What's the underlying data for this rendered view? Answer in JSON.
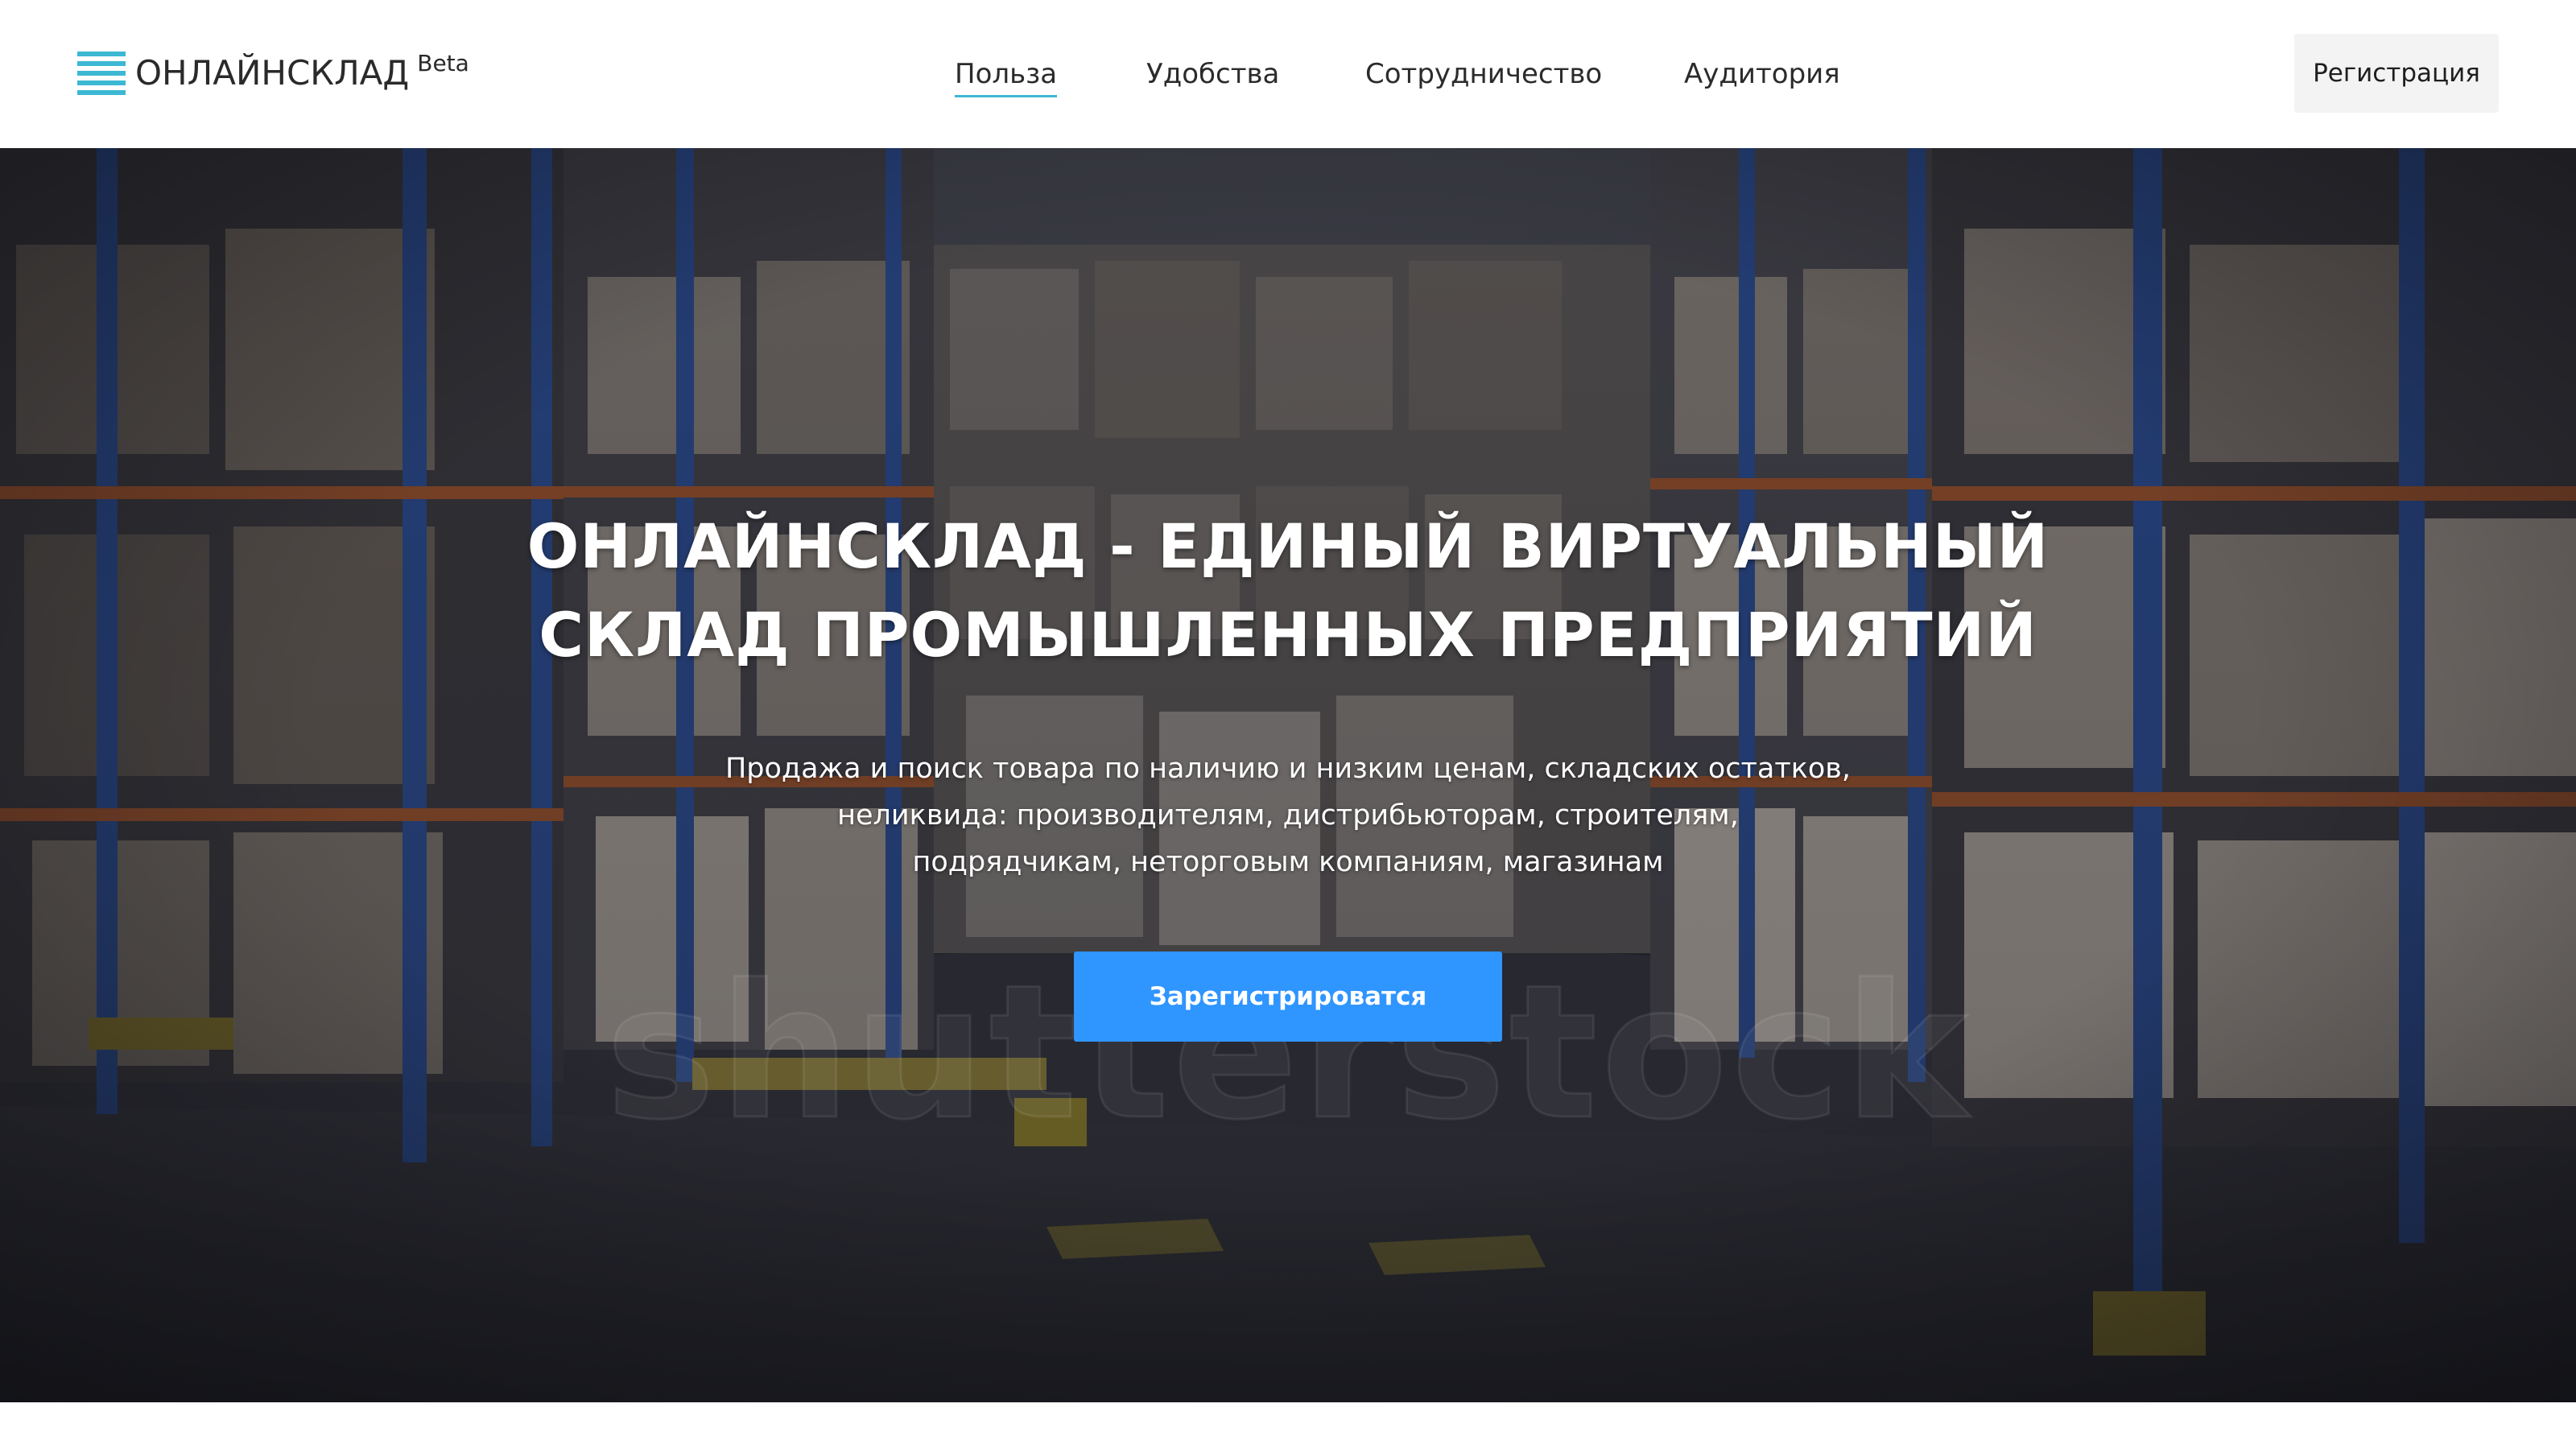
{
  "header": {
    "logo_text": "ОНЛАЙНСКЛАД",
    "logo_badge": "Beta",
    "nav": [
      {
        "label": "Польза",
        "active": true
      },
      {
        "label": "Удобства",
        "active": false
      },
      {
        "label": "Сотрудничество",
        "active": false
      },
      {
        "label": "Аудитория",
        "active": false
      }
    ],
    "register_label": "Регистрация"
  },
  "hero": {
    "title_lines": [
      "ОНЛАЙНСКЛАД - ЕДИНЫЙ ВИРТУАЛЬНЫЙ",
      "СКЛАД ПРОМЫШЛЕННЫХ ПРЕДПРИЯТИЙ"
    ],
    "subtitle_lines": [
      "Продажа и поиск товара по наличию и низким ценам, складских остатков,",
      "неликвида: производителям, дистрибьюторам, строителям,",
      "подрядчикам, неторговым компаниям, магазинам"
    ],
    "cta_label": "Зарегистрироватся",
    "watermark": "shutterstock"
  },
  "colors": {
    "accent": "#3cb8d3",
    "cta": "#2f95ff",
    "rack_blue": "#2a4f9a",
    "beam_orange": "#a4552a"
  },
  "icons": {
    "logo": "stacked-lines-icon"
  }
}
